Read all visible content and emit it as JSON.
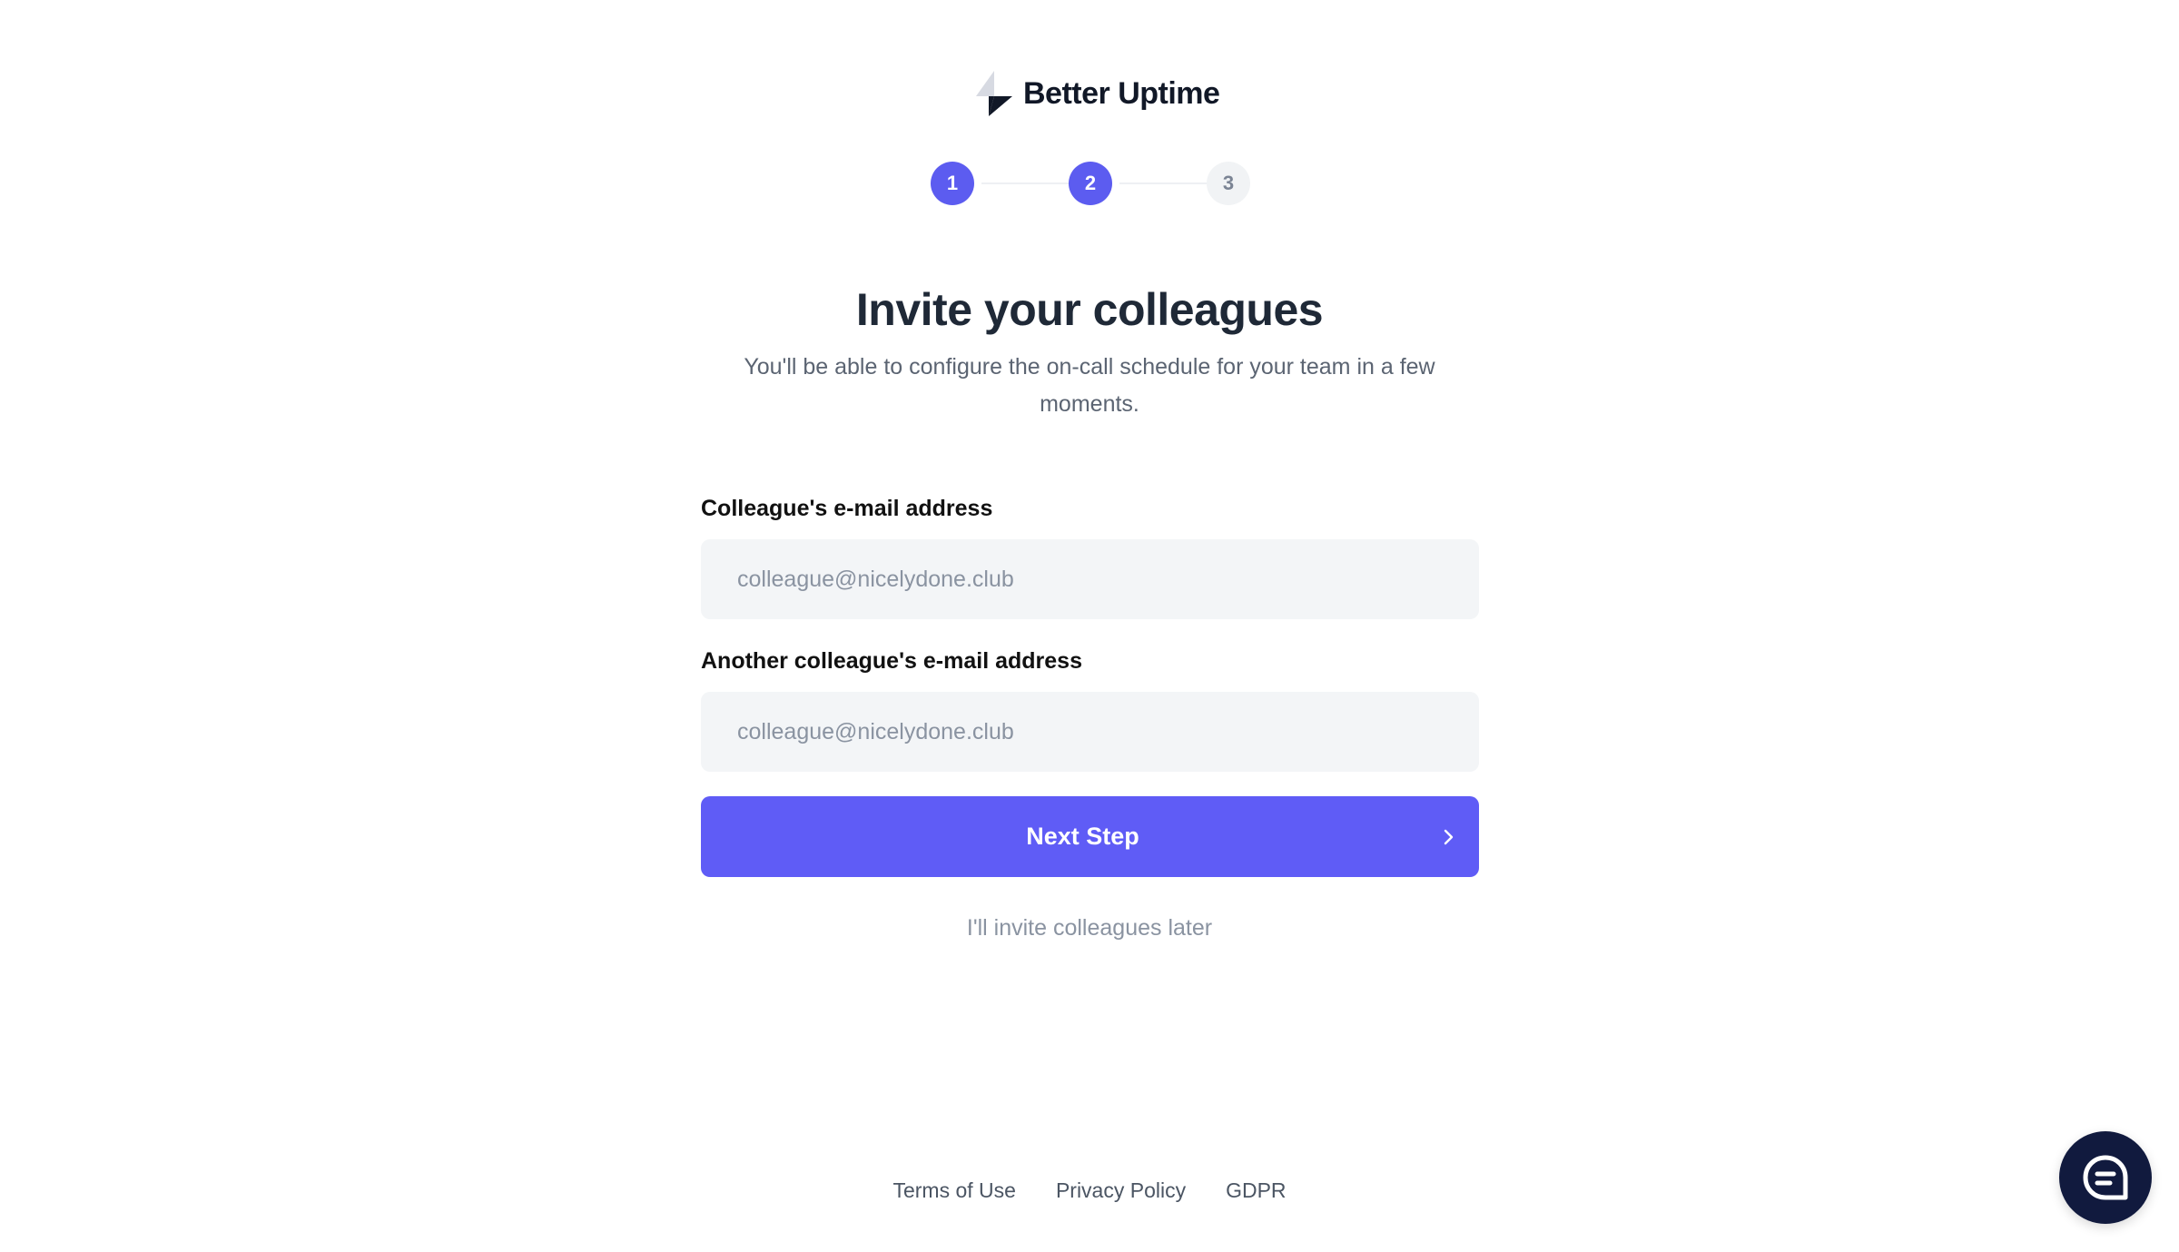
{
  "brand": {
    "name": "Better Uptime",
    "logo_icon": "lightning-bolt-icon",
    "text_color": "#111827"
  },
  "stepper": {
    "steps": [
      {
        "label": "1",
        "state": "complete"
      },
      {
        "label": "2",
        "state": "current"
      },
      {
        "label": "3",
        "state": "upcoming"
      }
    ],
    "active_color": "#5c5cf0"
  },
  "header": {
    "title": "Invite your colleagues",
    "subtitle": "You'll be able to configure the on-call schedule for your team in a few moments."
  },
  "form": {
    "fields": [
      {
        "label": "Colleague's e-mail address",
        "placeholder": "colleague@nicelydone.club",
        "value": ""
      },
      {
        "label": "Another colleague's e-mail address",
        "placeholder": "colleague@nicelydone.club",
        "value": ""
      }
    ],
    "submit": {
      "label": "Next Step",
      "icon": "chevron-right-icon",
      "color": "#5f5cf6"
    },
    "skip_link": "I'll invite colleagues later"
  },
  "footer": {
    "links": [
      "Terms of Use",
      "Privacy Policy",
      "GDPR"
    ]
  },
  "chat_widget": {
    "icon": "chat-bubble-icon",
    "color": "#111a3e"
  }
}
